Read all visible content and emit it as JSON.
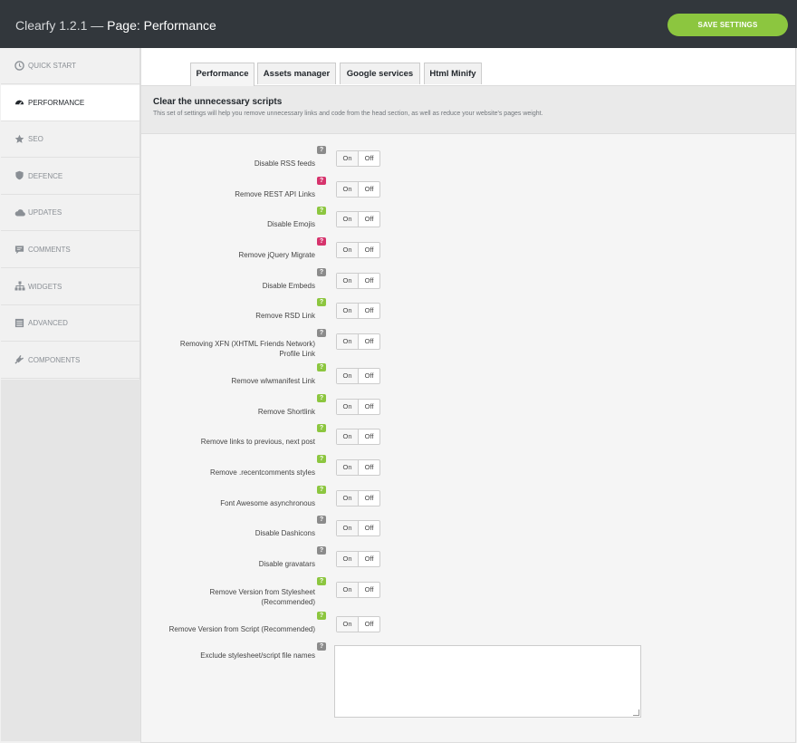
{
  "header": {
    "app": "Clearfy 1.2.1 —",
    "page": "Page: Performance",
    "save_label": "SAVE SETTINGS"
  },
  "sidebar": {
    "items": [
      {
        "label": "QUICK START",
        "icon": "clock-icon",
        "active": false
      },
      {
        "label": "PERFORMANCE",
        "icon": "dashboard-icon",
        "active": true
      },
      {
        "label": "SEO",
        "icon": "star-icon",
        "active": false
      },
      {
        "label": "DEFENCE",
        "icon": "shield-icon",
        "active": false
      },
      {
        "label": "UPDATES",
        "icon": "cloud-icon",
        "active": false
      },
      {
        "label": "COMMENTS",
        "icon": "comment-icon",
        "active": false
      },
      {
        "label": "WIDGETS",
        "icon": "sitemap-icon",
        "active": false
      },
      {
        "label": "ADVANCED",
        "icon": "list-icon",
        "active": false
      },
      {
        "label": "COMPONENTS",
        "icon": "plugin-icon",
        "active": false
      }
    ]
  },
  "tabs": [
    {
      "label": "Performance",
      "active": true
    },
    {
      "label": "Assets manager",
      "active": false
    },
    {
      "label": "Google services",
      "active": false
    },
    {
      "label": "Html Minify",
      "active": false
    }
  ],
  "section": {
    "title": "Clear the unnecessary scripts",
    "description": "This set of settings will help you remove unnecessary links and code from the head section, as well as reduce your website's pages weight."
  },
  "toggle": {
    "on": "On",
    "off": "Off"
  },
  "help_glyph": "?",
  "colors": {
    "grey": "#8b8b8b",
    "green": "#8cc63f",
    "red": "#d6336c"
  },
  "settings": [
    {
      "line1": "Disable RSS feeds",
      "line2": "",
      "help": "grey",
      "value": "Off"
    },
    {
      "line1": "Remove REST API Links",
      "line2": "",
      "help": "red",
      "value": "Off"
    },
    {
      "line1": "Disable Emojis",
      "line2": "",
      "help": "green",
      "value": "Off"
    },
    {
      "line1": "Remove jQuery Migrate",
      "line2": "",
      "help": "red",
      "value": "Off"
    },
    {
      "line1": "Disable Embeds",
      "line2": "",
      "help": "grey",
      "value": "Off"
    },
    {
      "line1": "Remove RSD Link",
      "line2": "",
      "help": "green",
      "value": "Off"
    },
    {
      "line1": "Removing XFN (XHTML Friends Network)",
      "line2": "Profile Link",
      "help": "grey",
      "value": "Off"
    },
    {
      "line1": "Remove wlwmanifest Link",
      "line2": "",
      "help": "green",
      "value": "Off"
    },
    {
      "line1": "Remove Shortlink",
      "line2": "",
      "help": "green",
      "value": "Off"
    },
    {
      "line1": "Remove links to previous, next post",
      "line2": "",
      "help": "green",
      "value": "Off"
    },
    {
      "line1": "Remove .recentcomments styles",
      "line2": "",
      "help": "green",
      "value": "Off"
    },
    {
      "line1": "Font Awesome asynchronous",
      "line2": "",
      "help": "green",
      "value": "Off"
    },
    {
      "line1": "Disable Dashicons",
      "line2": "",
      "help": "grey",
      "value": "Off"
    },
    {
      "line1": "Disable gravatars",
      "line2": "",
      "help": "grey",
      "value": "Off"
    },
    {
      "line1": "Remove Version from Stylesheet",
      "line2": "(Recommended)",
      "help": "green",
      "value": "Off"
    },
    {
      "line1": "Remove Version from Script (Recommended)",
      "line2": "",
      "help": "green",
      "value": "Off"
    }
  ],
  "exclude": {
    "label": "Exclude stylesheet/script file names",
    "value": "",
    "help": "grey"
  }
}
